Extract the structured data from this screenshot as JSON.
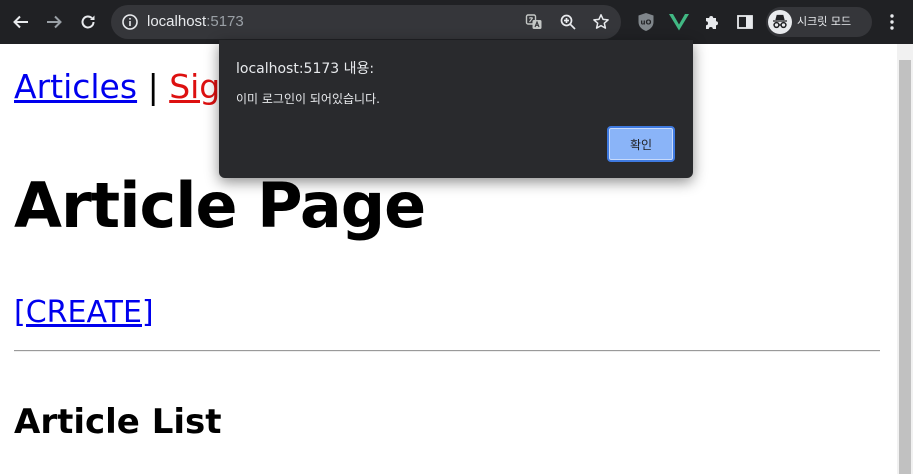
{
  "browser": {
    "url_host": "localhost",
    "url_port": ":5173",
    "profile_label": "시크릿 모드",
    "icons": {
      "back": "arrow-left-icon",
      "forward": "arrow-right-icon",
      "reload": "reload-icon",
      "site_info": "info-icon",
      "translate": "translate-icon",
      "zoom": "zoom-icon",
      "bookmark": "star-icon",
      "extension_ublock": "ublock-icon",
      "extension_vue": "vue-devtools-icon",
      "extensions": "puzzle-icon",
      "side_panel": "side-panel-icon",
      "incognito": "incognito-icon",
      "menu": "kebab-menu-icon"
    },
    "colors": {
      "toolbar": "#202124",
      "omnibox": "#35363a",
      "vue_green": "#41b883"
    }
  },
  "page": {
    "nav": {
      "articles_link": "Articles",
      "separator": "|",
      "signup_link": "Sign"
    },
    "title": "Article Page",
    "create_link": "[CREATE]",
    "list_title": "Article List"
  },
  "dialog": {
    "title": "localhost:5173 내용:",
    "message": "이미 로그인이 되어있습니다.",
    "ok_label": "확인",
    "colors": {
      "background": "#292a2d",
      "button": "#8ab4f8"
    }
  }
}
